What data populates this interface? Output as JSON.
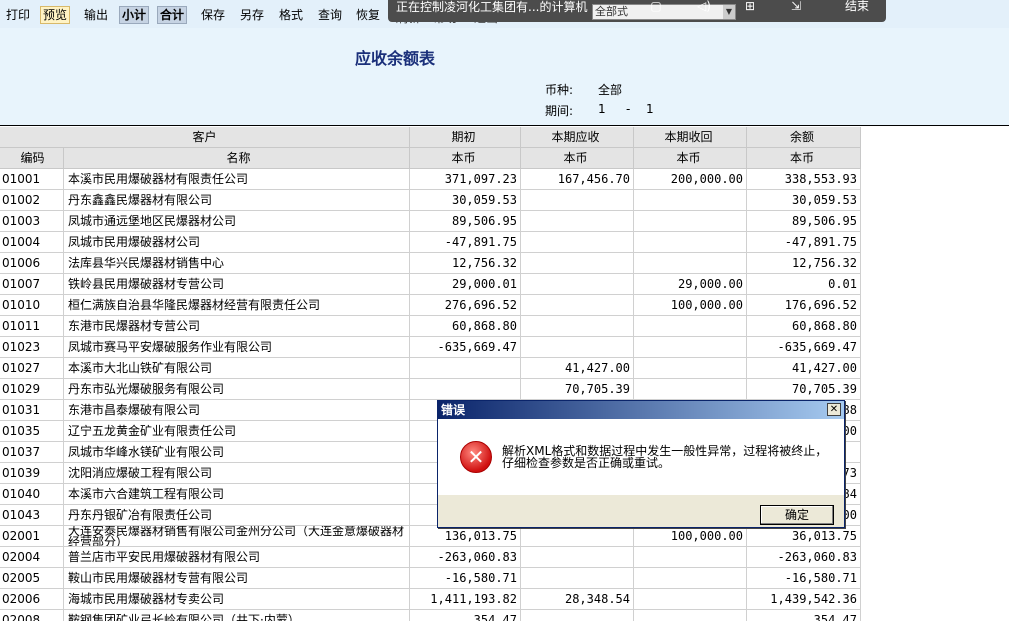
{
  "toolbar": {
    "items": [
      {
        "label": "打印",
        "state": "normal"
      },
      {
        "label": "预览",
        "state": "highlight"
      },
      {
        "label": "输出",
        "state": "normal"
      },
      {
        "label": "小计",
        "state": "pressed"
      },
      {
        "label": "合计",
        "state": "pressed"
      },
      {
        "label": "保存",
        "state": "normal"
      },
      {
        "label": "另存",
        "state": "normal"
      },
      {
        "label": "格式",
        "state": "normal"
      },
      {
        "label": "查询",
        "state": "normal"
      },
      {
        "label": "恢复",
        "state": "normal"
      }
    ],
    "ghost_items": [
      "刷新",
      "帮助",
      "退出"
    ]
  },
  "remote_bar": {
    "title": "正在控制凌河化工集团有...的计算机",
    "select_value": "全部式",
    "end_label": "结束"
  },
  "report": {
    "title": "应收余额表",
    "currency_label": "币种:",
    "currency_value": "全部",
    "period_label": "期间:",
    "period_from": "1",
    "period_sep": "-",
    "period_to": "1"
  },
  "table": {
    "header_top": {
      "customer": "客户",
      "opening": "期初",
      "due": "本期应收",
      "received": "本期收回",
      "balance": "余额"
    },
    "header_sub": {
      "code": "编码",
      "name": "名称",
      "opening": "本币",
      "due": "本币",
      "received": "本币",
      "balance": "本币"
    },
    "rows": [
      {
        "code": "01001",
        "name": "本溪市民用爆破器材有限责任公司",
        "opening": "371,097.23",
        "due": "167,456.70",
        "received": "200,000.00",
        "balance": "338,553.93"
      },
      {
        "code": "01002",
        "name": "丹东鑫鑫民爆器材有限公司",
        "opening": "30,059.53",
        "due": "",
        "received": "",
        "balance": "30,059.53"
      },
      {
        "code": "01003",
        "name": "凤城市通远堡地区民爆器材公司",
        "opening": "89,506.95",
        "due": "",
        "received": "",
        "balance": "89,506.95"
      },
      {
        "code": "01004",
        "name": "凤城市民用爆破器材公司",
        "opening": "-47,891.75",
        "due": "",
        "received": "",
        "balance": "-47,891.75"
      },
      {
        "code": "01006",
        "name": "法库县华兴民爆器材销售中心",
        "opening": "12,756.32",
        "due": "",
        "received": "",
        "balance": "12,756.32"
      },
      {
        "code": "01007",
        "name": "铁岭县民用爆破器材专营公司",
        "opening": "29,000.01",
        "due": "",
        "received": "29,000.00",
        "balance": "0.01"
      },
      {
        "code": "01010",
        "name": "桓仁满族自治县华隆民爆器材经营有限责任公司",
        "opening": "276,696.52",
        "due": "",
        "received": "100,000.00",
        "balance": "176,696.52"
      },
      {
        "code": "01011",
        "name": "东港市民爆器材专营公司",
        "opening": "60,868.80",
        "due": "",
        "received": "",
        "balance": "60,868.80"
      },
      {
        "code": "01023",
        "name": "凤城市赛马平安爆破服务作业有限公司",
        "opening": "-635,669.47",
        "due": "",
        "received": "",
        "balance": "-635,669.47"
      },
      {
        "code": "01027",
        "name": "本溪市大北山铁矿有限公司",
        "opening": "",
        "due": "41,427.00",
        "received": "",
        "balance": "41,427.00"
      },
      {
        "code": "01029",
        "name": "丹东市弘光爆破服务有限公司",
        "opening": "",
        "due": "70,705.39",
        "received": "",
        "balance": "70,705.39"
      },
      {
        "code": "01031",
        "name": "东港市昌泰爆破有限公司",
        "opening": "",
        "due": "",
        "received": "",
        "balance": "88"
      },
      {
        "code": "01035",
        "name": "辽宁五龙黄金矿业有限责任公司",
        "opening": "",
        "due": "",
        "received": "",
        "balance": "00"
      },
      {
        "code": "01037",
        "name": "凤城市华峰水镁矿业有限公司",
        "opening": "",
        "due": "",
        "received": "",
        "balance": ""
      },
      {
        "code": "01039",
        "name": "沈阳消应爆破工程有限公司",
        "opening": "",
        "due": "",
        "received": "",
        "balance": "73"
      },
      {
        "code": "01040",
        "name": "本溪市六合建筑工程有限公司",
        "opening": "",
        "due": "",
        "received": "",
        "balance": "84"
      },
      {
        "code": "01043",
        "name": "丹东丹银矿冶有限责任公司",
        "opening": "",
        "due": "",
        "received": "",
        "balance": "00"
      },
      {
        "code": "02001",
        "name": "大连安泰民爆器材销售有限公司金州分公司（大连金意爆破器材经营部分）",
        "opening": "136,013.75",
        "due": "",
        "received": "100,000.00",
        "balance": "36,013.75"
      },
      {
        "code": "02004",
        "name": "普兰店市平安民用爆破器材有限公司",
        "opening": "-263,060.83",
        "due": "",
        "received": "",
        "balance": "-263,060.83"
      },
      {
        "code": "02005",
        "name": "鞍山市民用爆破器材专营有限公司",
        "opening": "-16,580.71",
        "due": "",
        "received": "",
        "balance": "-16,580.71"
      },
      {
        "code": "02006",
        "name": "海城市民用爆破器材专卖公司",
        "opening": "1,411,193.82",
        "due": "28,348.54",
        "received": "",
        "balance": "1,439,542.36"
      },
      {
        "code": "02008",
        "name": "鞍钢集团矿业弓长岭有限公司（井下·内蒙）",
        "opening": "354.47",
        "due": "",
        "received": "",
        "balance": "354.47"
      }
    ]
  },
  "dialog": {
    "title": "错误",
    "message": "解析XML格式和数据过程中发生一般性异常，过程将被终止，仔细检查参数是否正确或重试。",
    "ok_label": "确定",
    "close_glyph": "✕",
    "icon_glyph": "✕"
  }
}
